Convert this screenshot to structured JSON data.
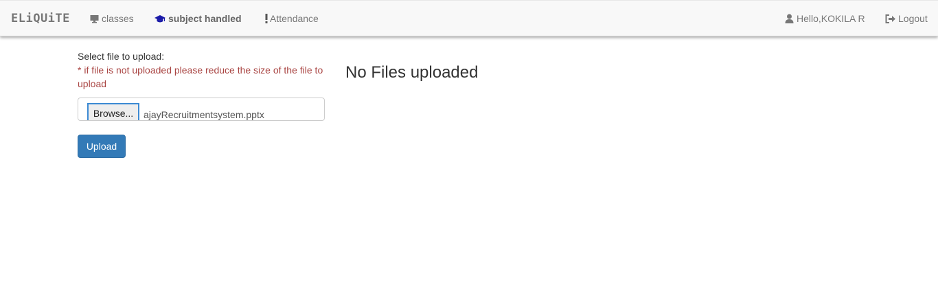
{
  "navbar": {
    "brand": "ELiQUiTE",
    "items": [
      {
        "label": "classes",
        "icon": "desktop-icon"
      },
      {
        "label": "subject handled",
        "icon": "graduation-cap-icon",
        "active": true
      },
      {
        "label": "Attendance",
        "icon": "exclamation-icon"
      }
    ],
    "user": {
      "label": "Hello,KOKILA R",
      "icon": "user-icon"
    },
    "logout": {
      "label": "Logout",
      "icon": "logout-icon"
    }
  },
  "upload_form": {
    "select_label": "Select file to upload:",
    "warning": "* if file is not uploaded please reduce the size of the file to upload",
    "browse_label": "Browse...",
    "file_name": "ajayRecruitmentsystem.pptx",
    "upload_label": "Upload"
  },
  "files_panel": {
    "message": "No Files uploaded"
  },
  "colors": {
    "primary": "#337ab7",
    "warning_text": "#a94442",
    "active_icon": "#1a1aa8",
    "navbar_bg": "#f8f8f8"
  }
}
